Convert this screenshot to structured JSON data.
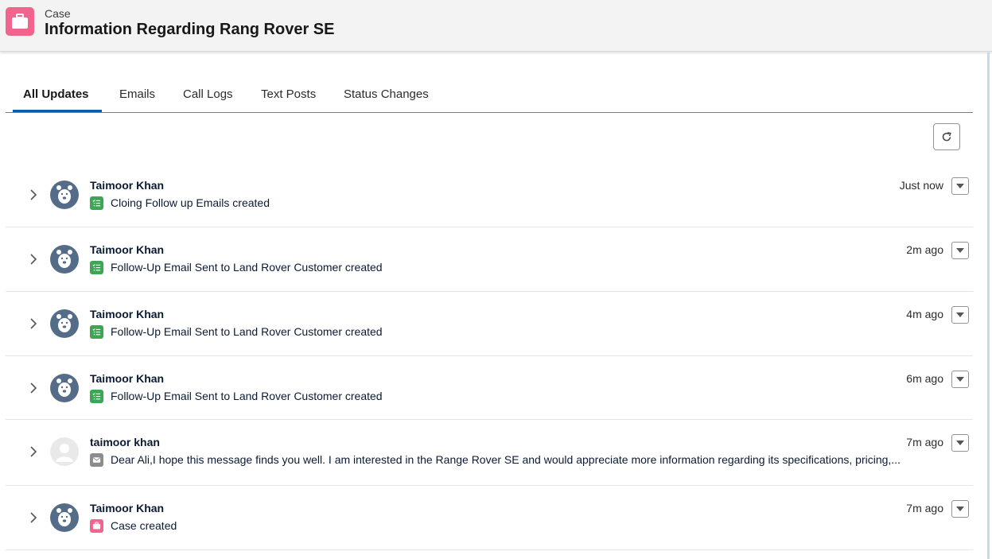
{
  "header": {
    "object_type": "Case",
    "title": "Information Regarding Rang Rover SE"
  },
  "tabs": [
    {
      "label": "All Updates"
    },
    {
      "label": "Emails"
    },
    {
      "label": "Call Logs"
    },
    {
      "label": "Text Posts"
    },
    {
      "label": "Status Changes"
    }
  ],
  "colors": {
    "accent": "#0b5cab",
    "case_icon": "#f2638d",
    "task_icon": "#3ba755",
    "email_icon": "#8c8c8c",
    "avatar": "#556c88"
  },
  "feed": [
    {
      "actor": "Taimoor Khan",
      "subject": "Cloing Follow up Emails created",
      "time": "Just now",
      "icon": "task-icon",
      "avatar": "bear-avatar"
    },
    {
      "actor": "Taimoor Khan",
      "subject": "Follow-Up Email Sent to Land Rover Customer created",
      "time": "2m ago",
      "icon": "task-icon",
      "avatar": "bear-avatar"
    },
    {
      "actor": "Taimoor Khan",
      "subject": "Follow-Up Email Sent to Land Rover Customer created",
      "time": "4m ago",
      "icon": "task-icon",
      "avatar": "bear-avatar"
    },
    {
      "actor": "Taimoor Khan",
      "subject": "Follow-Up Email Sent to Land Rover Customer created",
      "time": "6m ago",
      "icon": "task-icon",
      "avatar": "bear-avatar"
    },
    {
      "actor": "taimoor khan",
      "subject": "Dear Ali,I hope this message finds you well. I am interested in the Range Rover SE and would appreciate more information regarding its specifications, pricing,...",
      "time": "7m ago",
      "icon": "email-icon",
      "avatar": "placeholder-avatar"
    },
    {
      "actor": "Taimoor Khan",
      "subject": "Case created",
      "time": "7m ago",
      "icon": "case-icon",
      "avatar": "bear-avatar"
    }
  ]
}
